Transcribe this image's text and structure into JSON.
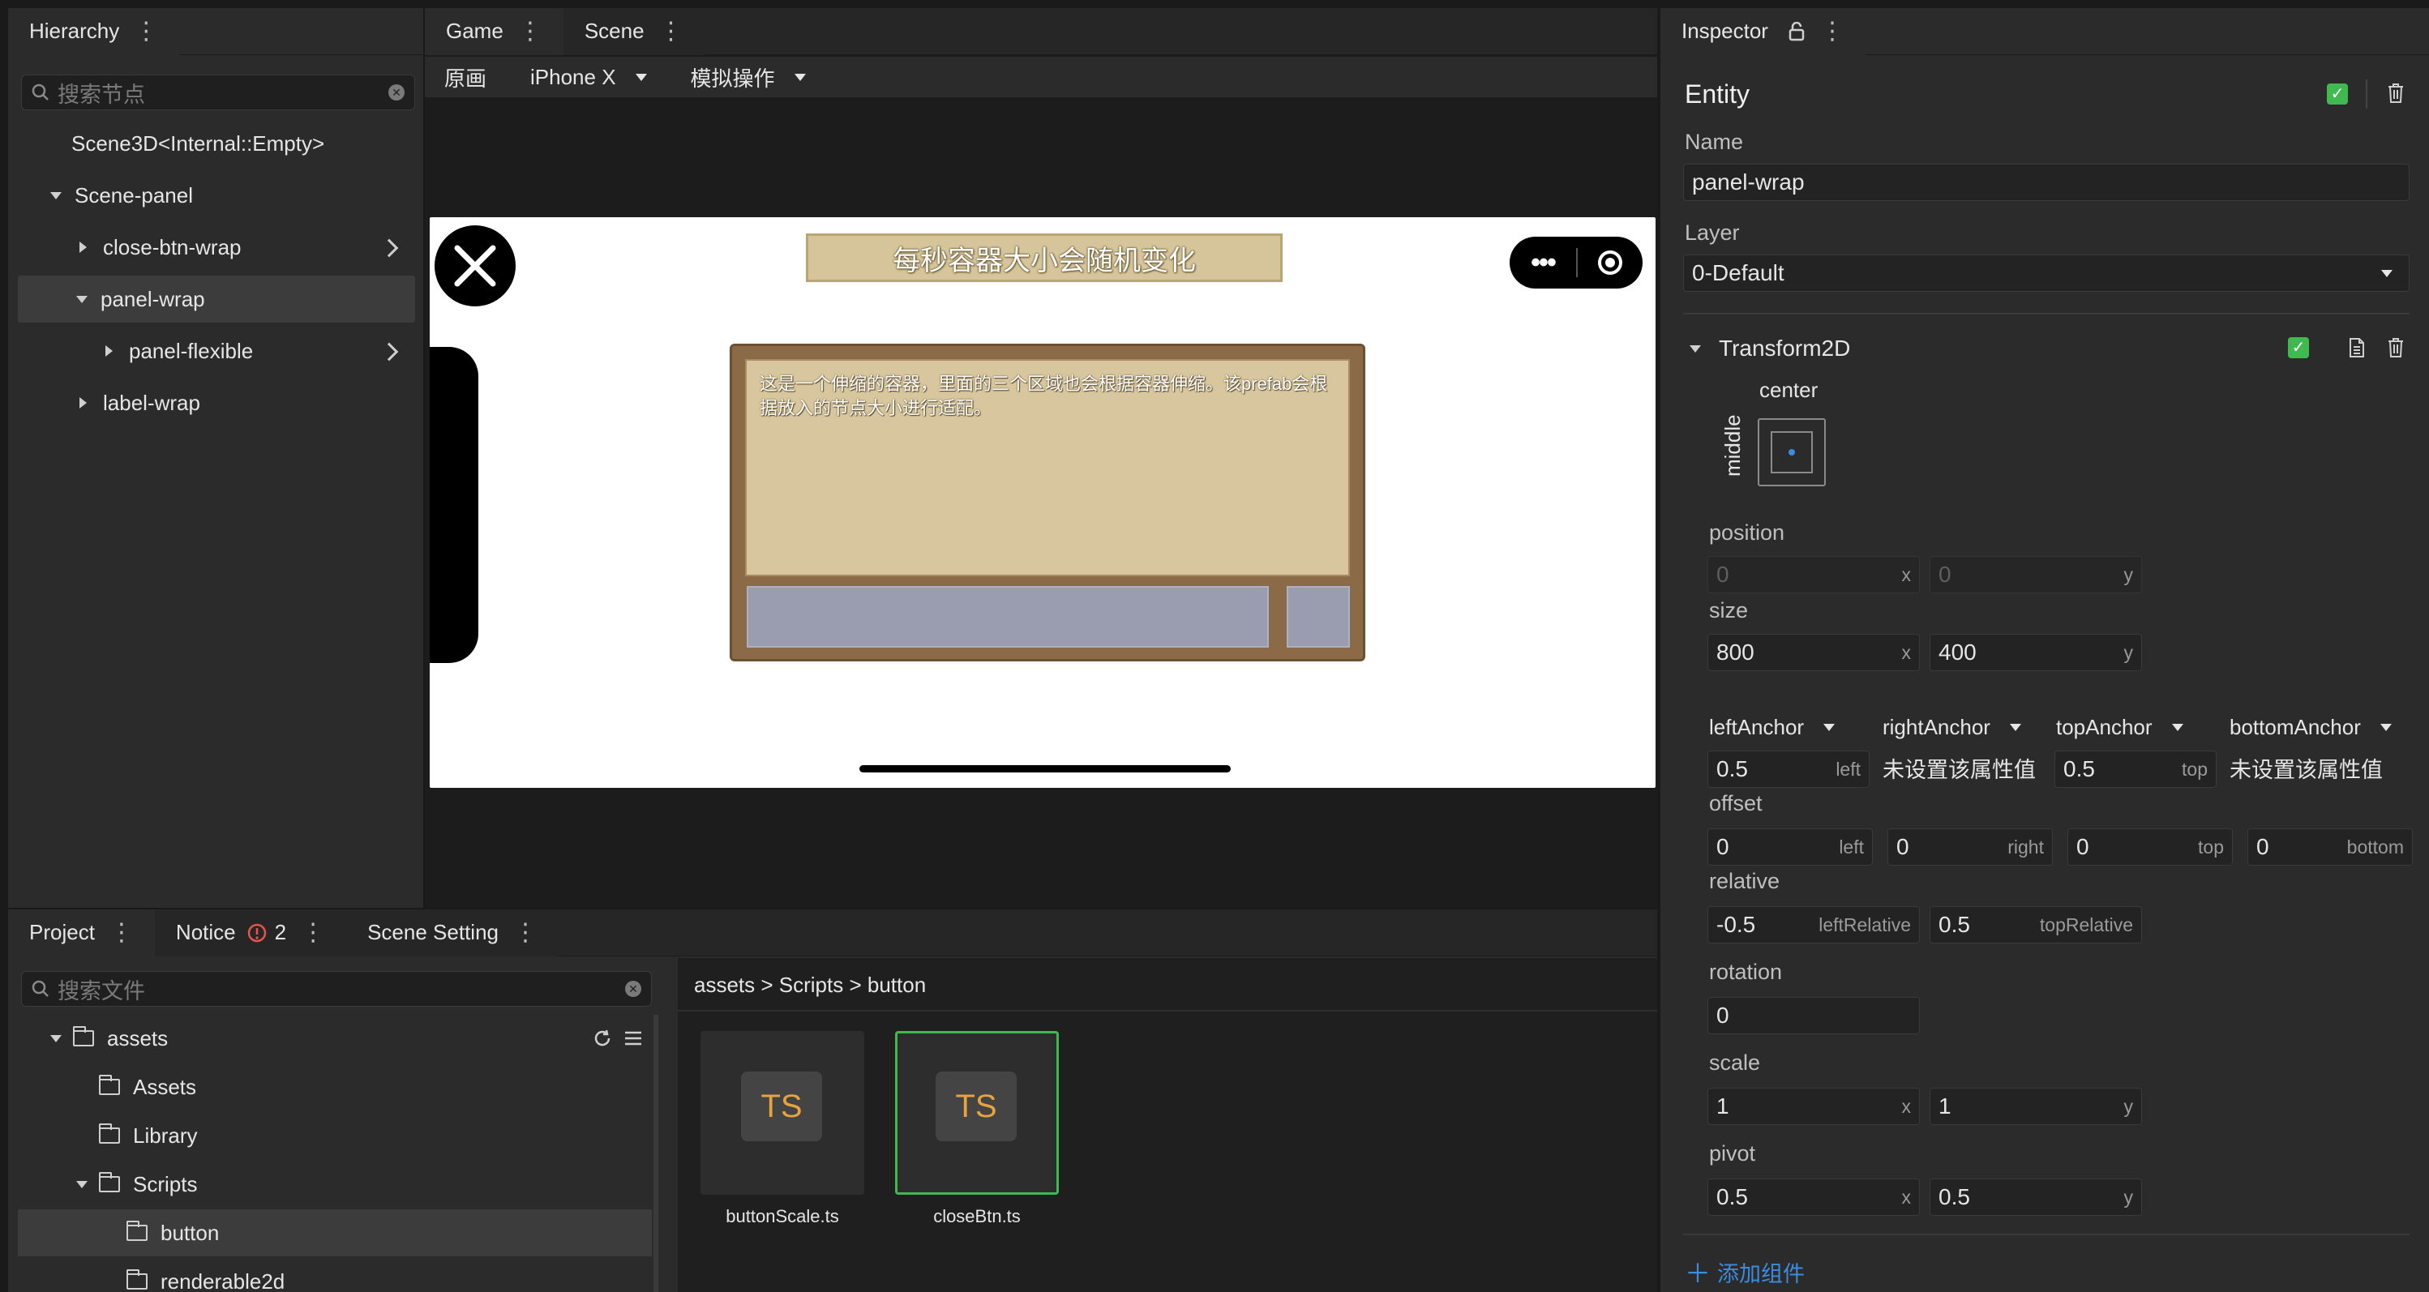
{
  "hierarchy": {
    "title": "Hierarchy",
    "search_placeholder": "搜索节点",
    "items": [
      {
        "label": "Scene3D<Internal::Empty>"
      },
      {
        "label": "Scene-panel"
      },
      {
        "label": "close-btn-wrap"
      },
      {
        "label": "panel-wrap"
      },
      {
        "label": "panel-flexible"
      },
      {
        "label": "label-wrap"
      }
    ]
  },
  "viewport": {
    "tabs": [
      {
        "label": "Game"
      },
      {
        "label": "Scene"
      }
    ],
    "toolbar": {
      "original": "原画",
      "device": "iPhone X",
      "simulate": "模拟操作"
    },
    "game": {
      "title": "每秒容器大小会随机变化",
      "description": "这是一个伸缩的容器，里面的三个区域也会根据容器伸缩。该prefab会根据放入的节点大小进行适配。"
    }
  },
  "project": {
    "tabs": [
      {
        "label": "Project"
      },
      {
        "label": "Notice",
        "badge": "2"
      },
      {
        "label": "Scene Setting"
      }
    ],
    "search_placeholder": "搜索文件",
    "tree": [
      {
        "label": "assets"
      },
      {
        "label": "Assets"
      },
      {
        "label": "Library"
      },
      {
        "label": "Scripts"
      },
      {
        "label": "button"
      },
      {
        "label": "renderable2d"
      }
    ],
    "breadcrumb": "assets > Scripts > button",
    "files": [
      {
        "name": "buttonScale.ts",
        "icon_text": "TS"
      },
      {
        "name": "closeBtn.ts",
        "icon_text": "TS"
      }
    ]
  },
  "inspector": {
    "title": "Inspector",
    "entity_label": "Entity",
    "name_label": "Name",
    "name_value": "panel-wrap",
    "layer_label": "Layer",
    "layer_value": "0-Default",
    "component": "Transform2D",
    "align_h": "center",
    "align_v": "middle",
    "position": {
      "label": "position",
      "x": "0",
      "y": "0"
    },
    "size": {
      "label": "size",
      "x": "800",
      "y": "400"
    },
    "anchors": {
      "left": {
        "label": "leftAnchor",
        "value": "0.5",
        "suffix": "left"
      },
      "right": {
        "label": "rightAnchor",
        "value": "未设置该属性值"
      },
      "top": {
        "label": "topAnchor",
        "value": "0.5",
        "suffix": "top"
      },
      "bottom": {
        "label": "bottomAnchor",
        "value": "未设置该属性值"
      }
    },
    "offset": {
      "label": "offset",
      "left": "0",
      "right": "0",
      "top": "0",
      "bottom": "0",
      "left_s": "left",
      "right_s": "right",
      "top_s": "top",
      "bottom_s": "bottom"
    },
    "relative": {
      "label": "relative",
      "left": "-0.5",
      "left_s": "leftRelative",
      "top": "0.5",
      "top_s": "topRelative"
    },
    "rotation": {
      "label": "rotation",
      "value": "0"
    },
    "scale": {
      "label": "scale",
      "x": "1",
      "y": "1"
    },
    "pivot": {
      "label": "pivot",
      "x": "0.5",
      "y": "0.5"
    },
    "axis_x": "x",
    "axis_y": "y",
    "add_component": "添加组件"
  },
  "colors": {
    "accent": "#3b8cde",
    "check": "#3fb950",
    "notice": "#e5534b",
    "ts": "#e8a33d"
  }
}
